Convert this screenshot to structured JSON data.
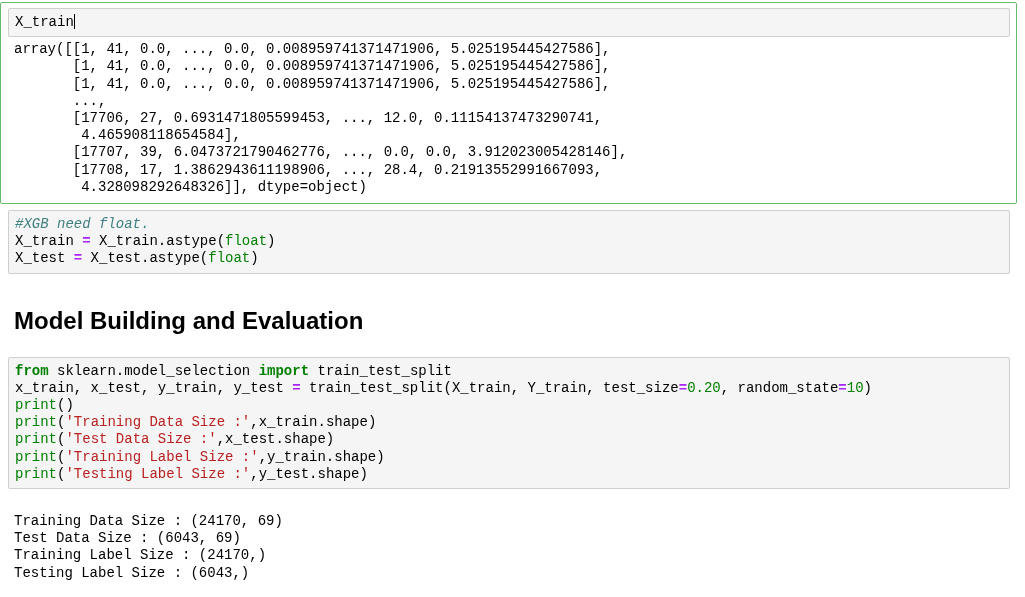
{
  "cells": [
    {
      "kind": "code",
      "selected": true,
      "editing": true,
      "input": [
        [
          {
            "text": "X_train",
            "kind": "plain"
          }
        ]
      ],
      "output": [
        "array([[1, 41, 0.0, ..., 0.0, 0.008959741371471906, 5.025195445427586],",
        "       [1, 41, 0.0, ..., 0.0, 0.008959741371471906, 5.025195445427586],",
        "       [1, 41, 0.0, ..., 0.0, 0.008959741371471906, 5.025195445427586],",
        "       ...,",
        "       [17706, 27, 0.6931471805599453, ..., 12.0, 0.11154137473290741,",
        "        4.465908118654584],",
        "       [17707, 39, 6.0473721790462776, ..., 0.0, 0.0, 3.912023005428146],",
        "       [17708, 17, 1.3862943611198906, ..., 28.4, 0.21913552991667093,",
        "        4.328098292648326]], dtype=object)"
      ]
    },
    {
      "kind": "code",
      "selected": false,
      "editing": false,
      "input": [
        [
          {
            "text": "#XGB need float.",
            "kind": "comment"
          }
        ],
        [
          {
            "text": "X_train ",
            "kind": "plain"
          },
          {
            "text": "=",
            "kind": "operator"
          },
          {
            "text": " X_train.astype(",
            "kind": "plain"
          },
          {
            "text": "float",
            "kind": "builtin"
          },
          {
            "text": ")",
            "kind": "plain"
          }
        ],
        [
          {
            "text": "X_test ",
            "kind": "plain"
          },
          {
            "text": "=",
            "kind": "operator"
          },
          {
            "text": " X_test.astype(",
            "kind": "plain"
          },
          {
            "text": "float",
            "kind": "builtin"
          },
          {
            "text": ")",
            "kind": "plain"
          }
        ]
      ]
    },
    {
      "kind": "markdown",
      "selected": false,
      "editing": false,
      "heading": "Model Building and Evaluation"
    },
    {
      "kind": "code",
      "selected": false,
      "editing": false,
      "input": [
        [
          {
            "text": "from",
            "kind": "keyword"
          },
          {
            "text": " sklearn.model_selection ",
            "kind": "plain"
          },
          {
            "text": "import",
            "kind": "keyword"
          },
          {
            "text": " train_test_split",
            "kind": "plain"
          }
        ],
        [
          {
            "text": "x_train, x_test, y_train, y_test ",
            "kind": "plain"
          },
          {
            "text": "=",
            "kind": "operator"
          },
          {
            "text": " train_test_split(X_train, Y_train, test_size",
            "kind": "plain"
          },
          {
            "text": "=",
            "kind": "operator"
          },
          {
            "text": "0.20",
            "kind": "number"
          },
          {
            "text": ", random_state",
            "kind": "plain"
          },
          {
            "text": "=",
            "kind": "operator"
          },
          {
            "text": "10",
            "kind": "number"
          },
          {
            "text": ")",
            "kind": "plain"
          }
        ],
        [
          {
            "text": "print",
            "kind": "builtin"
          },
          {
            "text": "()",
            "kind": "plain"
          }
        ],
        [
          {
            "text": "print",
            "kind": "builtin"
          },
          {
            "text": "(",
            "kind": "plain"
          },
          {
            "text": "'Training Data Size :'",
            "kind": "string"
          },
          {
            "text": ",x_train.shape)",
            "kind": "plain"
          }
        ],
        [
          {
            "text": "print",
            "kind": "builtin"
          },
          {
            "text": "(",
            "kind": "plain"
          },
          {
            "text": "'Test Data Size :'",
            "kind": "string"
          },
          {
            "text": ",x_test.shape)",
            "kind": "plain"
          }
        ],
        [
          {
            "text": "print",
            "kind": "builtin"
          },
          {
            "text": "(",
            "kind": "plain"
          },
          {
            "text": "'Training Label Size :'",
            "kind": "string"
          },
          {
            "text": ",y_train.shape)",
            "kind": "plain"
          }
        ],
        [
          {
            "text": "print",
            "kind": "builtin"
          },
          {
            "text": "(",
            "kind": "plain"
          },
          {
            "text": "'Testing Label Size :'",
            "kind": "string"
          },
          {
            "text": ",y_test.shape)",
            "kind": "plain"
          }
        ]
      ],
      "output": [
        "Training Data Size : (24170, 69)",
        "Test Data Size : (6043, 69)",
        "Training Label Size : (24170,)",
        "Testing Label Size : (6043,)"
      ]
    }
  ]
}
